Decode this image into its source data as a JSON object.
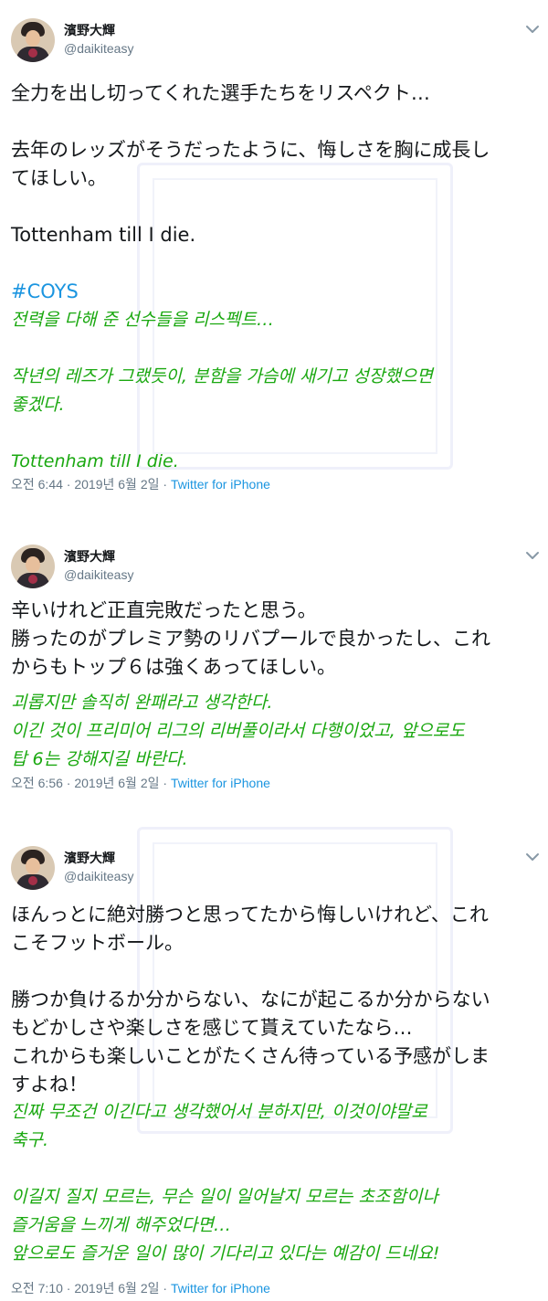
{
  "user": {
    "display_name": "濱野大輝",
    "handle": "@daikiteasy"
  },
  "colors": {
    "link": "#1b95e0",
    "muted": "#657786",
    "korean_translation": "#1aa810",
    "text": "#14171a"
  },
  "icons": {
    "menu": "chevron-down-icon",
    "avatar": "profile-photo"
  },
  "tweets": [
    {
      "lines": [
        "全力を出し切ってくれた選手たちをリスペクト…",
        "",
        "去年のレッズがそうだったように、悔しさを胸に成長し",
        "てほしい。",
        "",
        "Tottenham till I die.",
        "",
        "#COYS"
      ],
      "translation": [
        "전력을 다해 준 선수들을 리스펙트…",
        "",
        "작년의 레즈가 그랬듯이, 분함을 가슴에 새기고 성장했으면",
        "좋겠다.",
        "",
        "Tottenham till I die."
      ],
      "time": "오전 6:44",
      "date": "2019년 6월 2일",
      "source": "Twitter for iPhone"
    },
    {
      "lines": [
        "辛いけれど正直完敗だったと思う。",
        "勝ったのがプレミア勢のリバプールで良かったし、これ",
        "からもトップ６は強くあってほしい。"
      ],
      "translation": [
        "괴롭지만 솔직히 완패라고 생각한다.",
        "이긴 것이 프리미어 리그의 리버풀이라서 다행이었고, 앞으로도",
        "탑 6는 강해지길 바란다."
      ],
      "time": "오전 6:56",
      "date": "2019년 6월 2일",
      "source": "Twitter for iPhone"
    },
    {
      "lines": [
        "ほんっとに絶対勝つと思ってたから悔しいけれど、これ",
        "こそフットボール。",
        "",
        "勝つか負けるか分からない、なにが起こるか分からない",
        "もどかしさや楽しさを感じて貰えていたなら…",
        "これからも楽しいことがたくさん待っている予感がしま",
        "すよね！"
      ],
      "translation": [
        "진짜 무조건 이긴다고 생각했어서 분하지만, 이것이야말로",
        "축구.",
        "",
        "이길지 질지 모르는, 무슨 일이 일어날지 모르는 초조함이나",
        "즐거움을 느끼게 해주었다면…",
        "앞으로도 즐거운 일이 많이 기다리고 있다는 예감이 드네요!"
      ],
      "time": "오전 7:10",
      "date": "2019년 6월 2일",
      "source": "Twitter for iPhone"
    }
  ]
}
